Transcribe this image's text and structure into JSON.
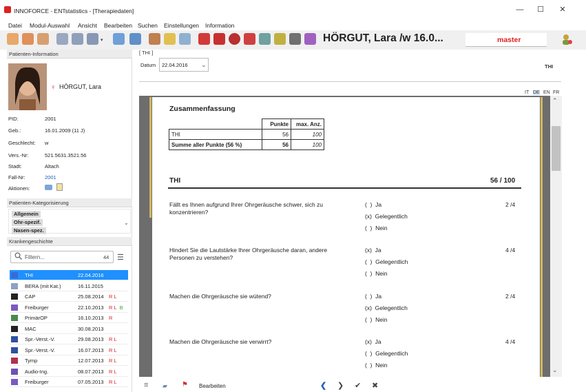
{
  "window": {
    "title": "INNOFORCE - ENTstatistics - [Therapiedaten]",
    "min": "—",
    "max": "☐",
    "close": "✕"
  },
  "menu": [
    "Datei",
    "Modul-Auswahl",
    "Ansicht",
    "Bearbeiten",
    "Suchen",
    "Einstellungen",
    "Information"
  ],
  "header": {
    "patient_name": "HÖRGUT, Lara /w 16.0...",
    "mode": "master"
  },
  "left": {
    "patient_info_title": "Patienten-Information",
    "name": "HÖRGUT, Lara",
    "fields": [
      {
        "label": "PID:",
        "value": "2001"
      },
      {
        "label": "Geb.:",
        "value": "16.01.2009 (11 J)"
      },
      {
        "label": "Geschlecht:",
        "value": "w"
      },
      {
        "label": "Vers.-Nr:",
        "value": "521.5631.3521.56"
      },
      {
        "label": "Stadt:",
        "value": "Altach"
      },
      {
        "label": "Fall-Nr:",
        "value": "2001"
      },
      {
        "label": "Aktionen:",
        "value": ""
      }
    ],
    "category_title": "Patienten-Kategorisierung",
    "categories": [
      "Allgemein",
      "Ohr-spezif.",
      "Nasen-spez."
    ],
    "history_title": "Krankengeschichte",
    "filter_placeholder": "Filtern...",
    "filter_count": "44",
    "history": [
      {
        "name": "THI",
        "date": "22.04.2016",
        "flags": "",
        "icon": "thi-icon",
        "selected": true
      },
      {
        "name": "BERA (mit Kat.)",
        "date": "16.11.2015",
        "flags": "",
        "icon": "bera-icon"
      },
      {
        "name": "CAP",
        "date": "25.08.2014",
        "flags": "R L",
        "icon": "cap-icon"
      },
      {
        "name": "Freiburger",
        "date": "22.10.2013",
        "flags": "R L",
        "flagb": "B",
        "icon": "freiburger-icon"
      },
      {
        "name": "PrimärOP",
        "date": "16.10.2013",
        "flags": "R",
        "icon": "op-icon"
      },
      {
        "name": "MAC",
        "date": "30.08.2013",
        "flags": "",
        "icon": "mac-icon"
      },
      {
        "name": "Spr.-Verst.-V.",
        "date": "29.08.2013",
        "flags": "R L",
        "icon": "speech-icon"
      },
      {
        "name": "Spr.-Verst.-V.",
        "date": "16.07.2013",
        "flags": "R L",
        "icon": "speech-icon"
      },
      {
        "name": "Tymp",
        "date": "12.07.2013",
        "flags": "R L",
        "icon": "tymp-icon"
      },
      {
        "name": "Audio-Ing.",
        "date": "08.07.2013",
        "flags": "R L",
        "icon": "audio-icon"
      },
      {
        "name": "Freiburger",
        "date": "07.05.2013",
        "flags": "R L",
        "icon": "freiburger-icon"
      }
    ]
  },
  "main": {
    "tab": "[ THI ]",
    "date_label": "Datum",
    "date_value": "22.04.2016",
    "right_label": "THI",
    "languages": [
      "IT",
      "DE",
      "EN",
      "FR"
    ],
    "active_language": "DE",
    "summary_title": "Zusammenfassung",
    "summary_headers": [
      "",
      "Punkte",
      "max. Anz."
    ],
    "summary_rows": [
      {
        "label": "THI",
        "points": "56",
        "max": "100"
      },
      {
        "label": "Summe aller Punkte (56 %)",
        "points": "56",
        "max": "100"
      }
    ],
    "section_title": "THI",
    "section_score": "56 / 100",
    "questions": [
      {
        "text": "Fällt es Ihnen aufgrund Ihrer Ohrgeräusche schwer, sich zu konzentrieren?",
        "score": "2 /4",
        "options": [
          "(  )  Ja",
          "(x)  Gelegentlich",
          "(  )  Nein"
        ]
      },
      {
        "text": "Hindert Sie die Lautstärke Ihrer Ohrgeräusche daran, andere Personen zu verstehen?",
        "score": "4 /4",
        "options": [
          "(x)  Ja",
          "(  )  Gelegentlich",
          "(  )  Nein"
        ]
      },
      {
        "text": "Machen die Ohrgeräusche sie wütend?",
        "score": "2 /4",
        "options": [
          "(  )  Ja",
          "(x)  Gelegentlich",
          "(  )  Nein"
        ]
      },
      {
        "text": "Machen die Ohrgeräusche sie verwirrt?",
        "score": "4 /4",
        "options": [
          "(x)  Ja",
          "(  )  Gelegentlich",
          "(  )  Nein"
        ]
      }
    ],
    "bottom_edit": "Bearbeiten"
  }
}
